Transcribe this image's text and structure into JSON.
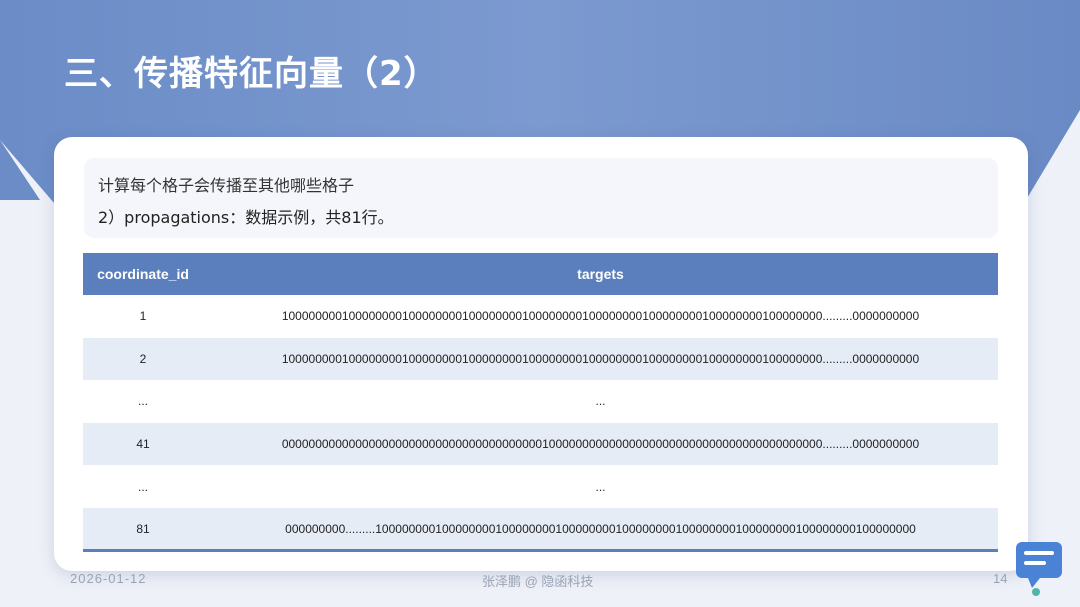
{
  "slide": {
    "title": "三、传播特征向量（2）",
    "intro_line1": "计算每个格子会传播至其他哪些格子",
    "intro_line2": "2）propagations：数据示例，共81行。"
  },
  "table": {
    "headers": [
      "coordinate_id",
      "targets"
    ],
    "rows": [
      {
        "id": "1",
        "targets": "100000000100000000100000000100000000100000000100000000100000000100000000100000000.........0000000000"
      },
      {
        "id": "2",
        "targets": "100000000100000000100000000100000000100000000100000000100000000100000000100000000.........0000000000"
      },
      {
        "id": "...",
        "targets": "..."
      },
      {
        "id": "41",
        "targets": "000000000000000000000000000000000000000100000000000000000000000000000000000000000.........0000000000"
      },
      {
        "id": "...",
        "targets": "..."
      },
      {
        "id": "81",
        "targets": "000000000.........100000000100000000100000000100000000100000000100000000100000000100000000100000000"
      }
    ]
  },
  "footer": {
    "date": "2026-01-12",
    "author": "张泽鹏 @ 隐函科技",
    "page": "14"
  },
  "colors": {
    "header_bg": "#5b7fbd",
    "row_shade": "#e6ecf6",
    "background": "#eef1f8"
  },
  "icons": [
    "chat-bubble-icon"
  ]
}
